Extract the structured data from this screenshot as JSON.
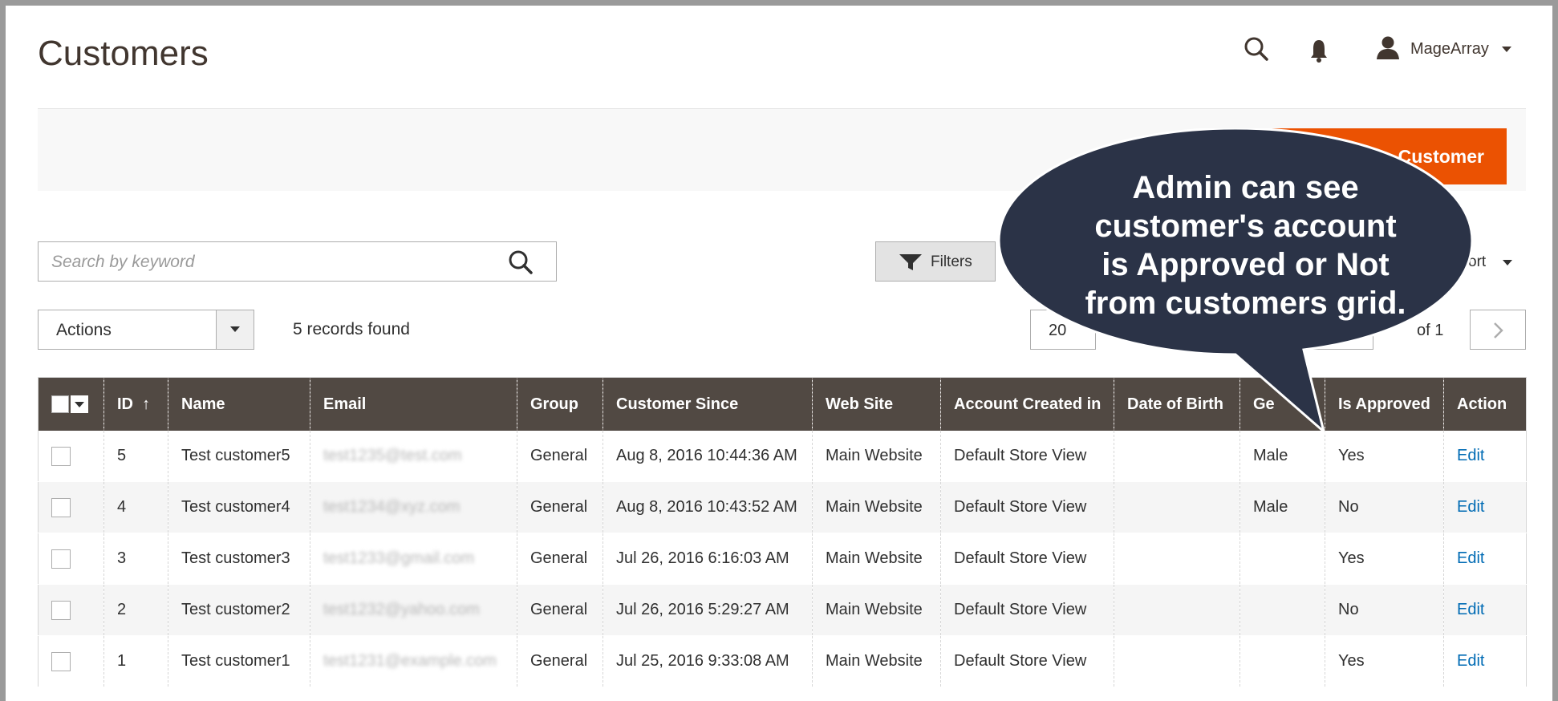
{
  "header": {
    "title": "Customers",
    "user_name": "MageArray"
  },
  "actionbar": {
    "add_button_label": "Customer"
  },
  "toolbar": {
    "search_placeholder": "Search by keyword",
    "filters_label": "Filters",
    "export_label": "ort",
    "actions_label": "Actions",
    "records_found": "5 records found",
    "per_page": "20",
    "of_pages": "of 1"
  },
  "callout": {
    "lines": [
      "Admin can see",
      "customer's account",
      "is Approved or Not",
      "from customers grid."
    ]
  },
  "grid": {
    "columns": [
      "ID",
      "Name",
      "Email",
      "Group",
      "Customer Since",
      "Web Site",
      "Account Created in",
      "Date of Birth",
      "Ge",
      "Is Approved",
      "Action"
    ],
    "sort_indicator": "↑",
    "rows": [
      {
        "id": "5",
        "name": "Test customer5",
        "email": "test1235@test.com",
        "group": "General",
        "since": "Aug 8, 2016 10:44:36 AM",
        "website": "Main Website",
        "created_in": "Default Store View",
        "dob": "",
        "gender": "Male",
        "approved": "Yes",
        "action": "Edit"
      },
      {
        "id": "4",
        "name": "Test customer4",
        "email": "test1234@xyz.com",
        "group": "General",
        "since": "Aug 8, 2016 10:43:52 AM",
        "website": "Main Website",
        "created_in": "Default Store View",
        "dob": "",
        "gender": "Male",
        "approved": "No",
        "action": "Edit"
      },
      {
        "id": "3",
        "name": "Test customer3",
        "email": "test1233@gmail.com",
        "group": "General",
        "since": "Jul 26, 2016 6:16:03 AM",
        "website": "Main Website",
        "created_in": "Default Store View",
        "dob": "",
        "gender": "",
        "approved": "Yes",
        "action": "Edit"
      },
      {
        "id": "2",
        "name": "Test customer2",
        "email": "test1232@yahoo.com",
        "group": "General",
        "since": "Jul 26, 2016 5:29:27 AM",
        "website": "Main Website",
        "created_in": "Default Store View",
        "dob": "",
        "gender": "",
        "approved": "No",
        "action": "Edit"
      },
      {
        "id": "1",
        "name": "Test customer1",
        "email": "test1231@example.com",
        "group": "General",
        "since": "Jul 25, 2016 9:33:08 AM",
        "website": "Main Website",
        "created_in": "Default Store View",
        "dob": "",
        "gender": "",
        "approved": "Yes",
        "action": "Edit"
      }
    ]
  },
  "colors": {
    "accent": "#eb5202",
    "grid_header": "#514943",
    "callout": "#2b3347",
    "link": "#006bb4"
  }
}
